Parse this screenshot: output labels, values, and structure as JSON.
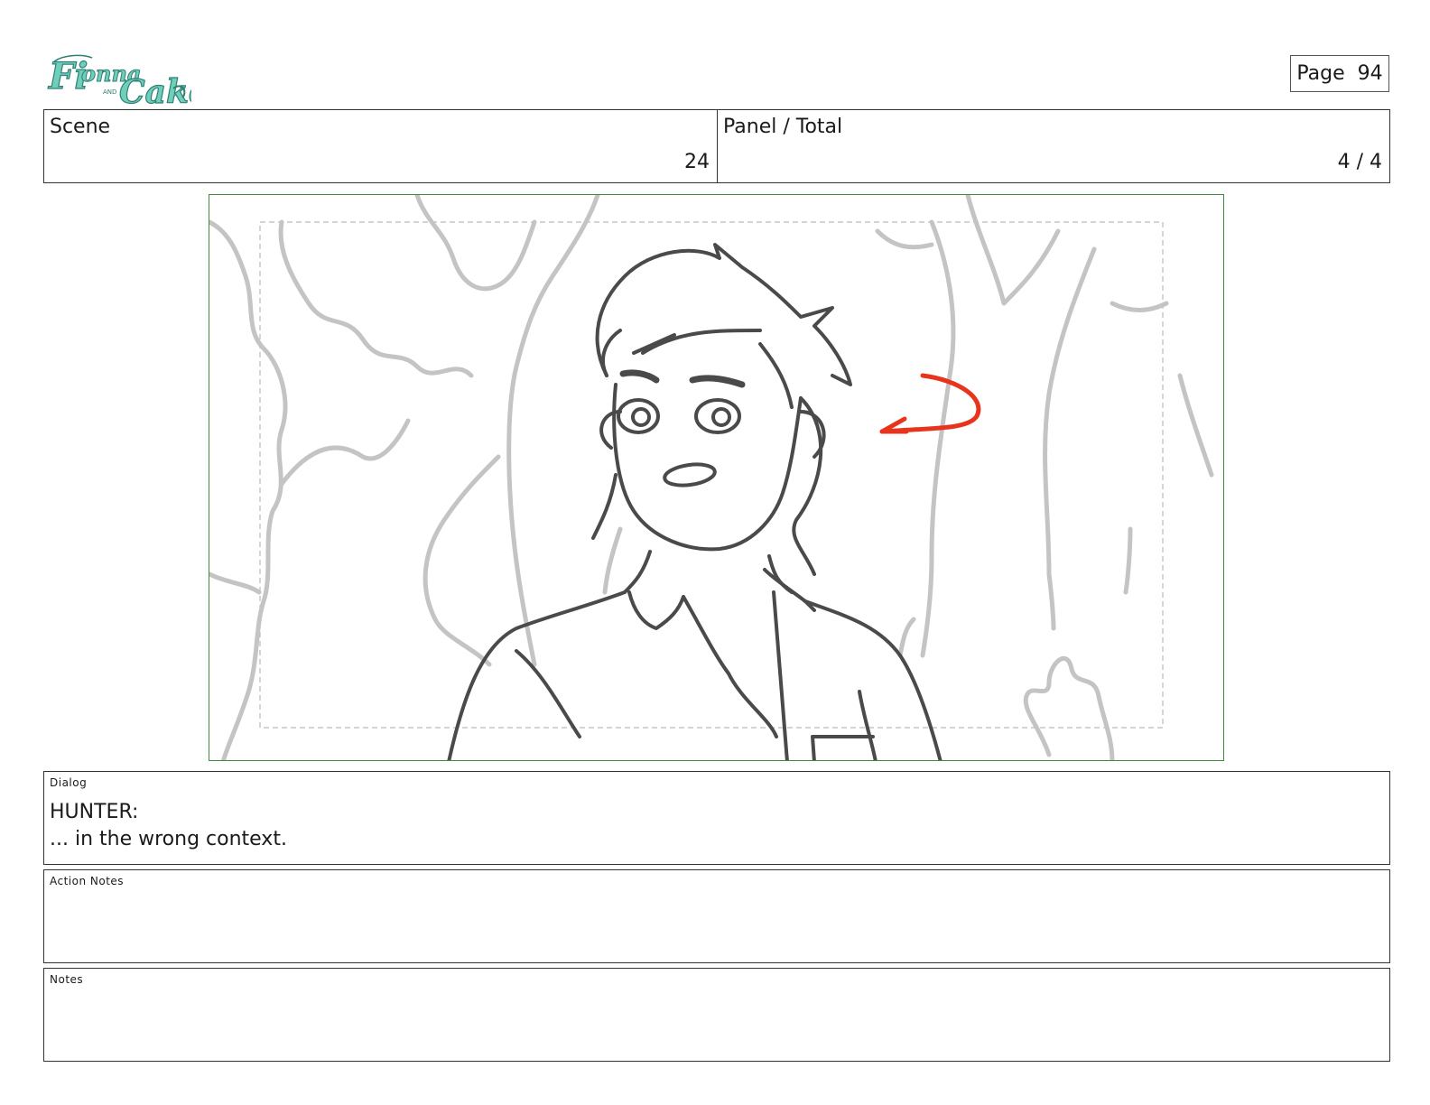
{
  "header": {
    "logo": {
      "name": "fionna-and-cake-logo",
      "text": "Fionna and Cake",
      "color": "#5fc4b0"
    },
    "page_label": "Page",
    "page_number": "94"
  },
  "info": {
    "scene_label": "Scene",
    "scene_value": "24",
    "panel_label": "Panel / Total",
    "panel_value": "4 / 4"
  },
  "panel": {
    "description_icon": "storyboard-sketch",
    "frame_color": "#3d8b3d",
    "arrow_color": "#e8341c"
  },
  "dialog": {
    "label": "Dialog",
    "speaker": "HUNTER:",
    "line": "... in the wrong context."
  },
  "action_notes": {
    "label": "Action Notes",
    "text": ""
  },
  "notes": {
    "label": "Notes",
    "text": ""
  }
}
